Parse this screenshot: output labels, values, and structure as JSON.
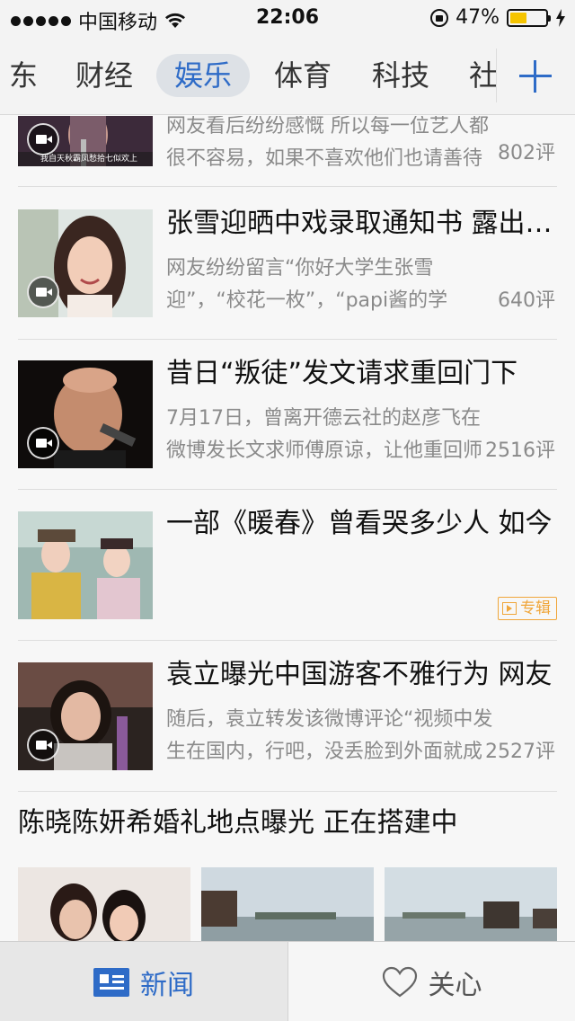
{
  "status_bar": {
    "carrier": "中国移动",
    "time": "22:06",
    "battery_percent": "47%",
    "battery_level": 0.47
  },
  "channels": {
    "items": [
      {
        "label": "东"
      },
      {
        "label": "财经"
      },
      {
        "label": "娱乐",
        "active": true
      },
      {
        "label": "体育"
      },
      {
        "label": "科技"
      },
      {
        "label": "社"
      }
    ],
    "add_icon": "plus-icon"
  },
  "feed": {
    "items": [
      {
        "title": "",
        "desc": "网友看后纷纷感慨 所以每一位艺人都很不容易，如果不喜欢他们也请善待他们",
        "comments": "802评",
        "has_video": true,
        "thumb_caption": "我自天秋霸凤愁拾七似欢上"
      },
      {
        "title": "张雪迎晒中戏录取通知书 露出正脸",
        "desc": "网友纷纷留言“你好大学生张雪迎”，“校花一枚”，“papi酱的学妹”。",
        "comments": "640评",
        "has_video": true
      },
      {
        "title": "昔日“叛徒”发文请求重回门下",
        "desc": "7月17日，曾离开德云社的赵彦飞在微博发长文求师傅原谅，让他重回师门。",
        "comments": "2516评",
        "has_video": true
      },
      {
        "title": "一部《暖春》曾看哭多少人 如今",
        "desc": "",
        "tag": "专辑",
        "has_video": false
      },
      {
        "title": "袁立曝光中国游客不雅行为 网友",
        "desc": "随后，袁立转发该微博评论“视频中发生在国内，行吧，没丢脸到外面就成”",
        "comments": "2527评",
        "has_video": true
      }
    ],
    "gallery": {
      "title": "陈晓陈妍希婚礼地点曝光 正在搭建中"
    }
  },
  "tabbar": {
    "news": {
      "label": "新闻",
      "icon": "newspaper-icon",
      "active": true
    },
    "care": {
      "label": "关心",
      "icon": "heart-icon"
    }
  },
  "colors": {
    "accent": "#2e6bc7",
    "tag": "#f0a63a",
    "battery": "#f5c400"
  }
}
